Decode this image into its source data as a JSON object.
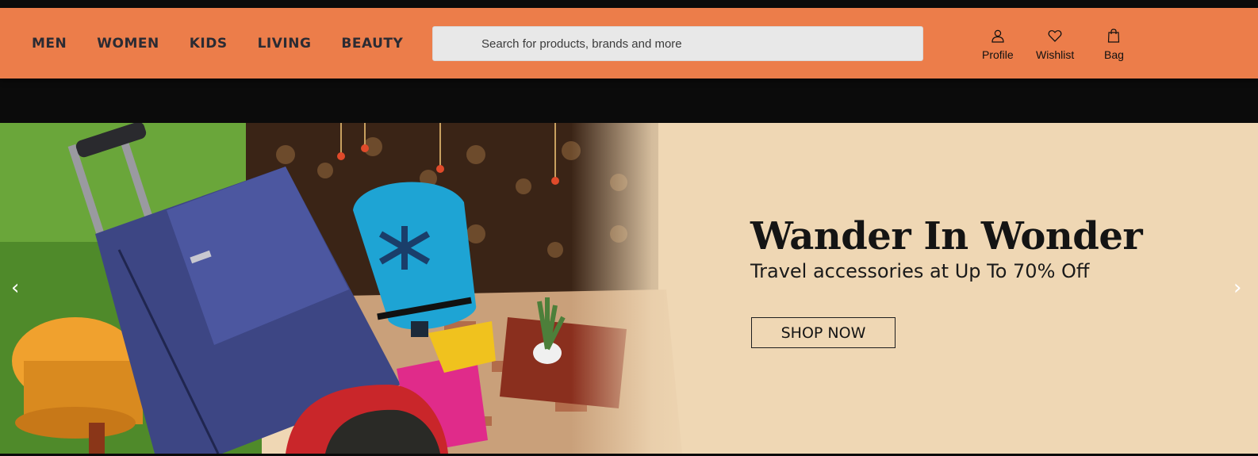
{
  "nav": {
    "items": [
      {
        "label": "MEN"
      },
      {
        "label": "WOMEN"
      },
      {
        "label": "KIDS"
      },
      {
        "label": "LIVING"
      },
      {
        "label": "BEAUTY"
      }
    ]
  },
  "search": {
    "placeholder": "Search for products, brands and more",
    "value": ""
  },
  "actions": {
    "profile": {
      "label": "Profile",
      "icon": "user-icon"
    },
    "wishlist": {
      "label": "Wishlist",
      "icon": "heart-icon"
    },
    "bag": {
      "label": "Bag",
      "icon": "bag-icon"
    }
  },
  "banner": {
    "headline": "Wander In Wonder",
    "subline": "Travel accessories at Up To 70% Off",
    "cta_label": "SHOP NOW",
    "prev_arrow": "‹",
    "next_arrow": "›",
    "image_subject": "luggage-suitcase-backpack-scene"
  },
  "colors": {
    "header_bg": "#ec7d4a",
    "banner_bg": "#efd7b4",
    "nav_text": "#2b2b33"
  }
}
